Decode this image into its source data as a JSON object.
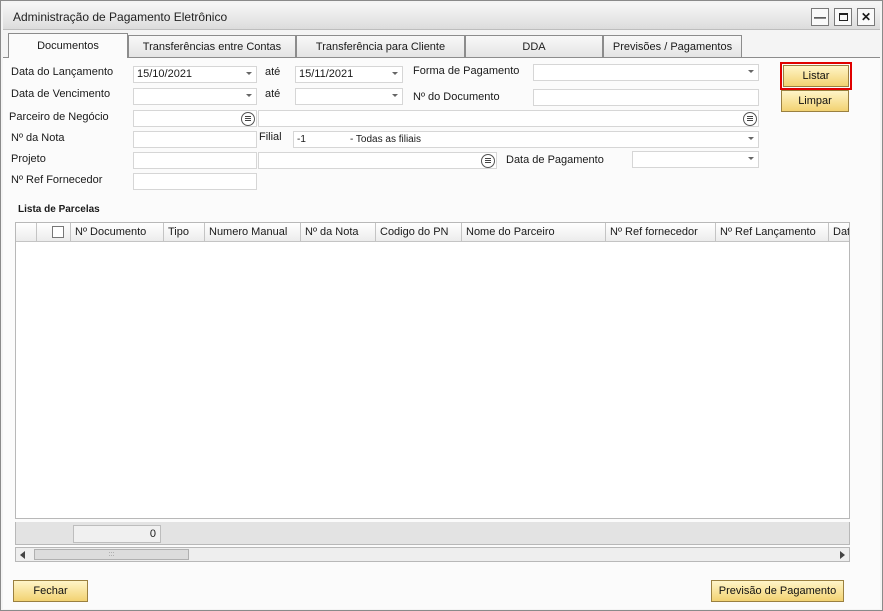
{
  "window": {
    "title": "Administração de Pagamento Eletrônico"
  },
  "tabs": [
    "Documentos",
    "Transferências entre Contas",
    "Transferência para Cliente",
    "DDA",
    "Previsões / Pagamentos"
  ],
  "form": {
    "data_lancamento_label": "Data do Lançamento",
    "data_lancamento_from": "15/10/2021",
    "ate_label_1": "até",
    "data_lancamento_to": "15/11/2021",
    "forma_pagamento_label": "Forma de Pagamento",
    "forma_pagamento_value": "",
    "data_vencimento_label": "Data de Vencimento",
    "data_vencimento_from": "",
    "ate_label_2": "até",
    "data_vencimento_to": "",
    "num_documento_label": "Nº do Documento",
    "num_documento_value": "",
    "parceiro_label": "Parceiro de Negócio",
    "parceiro_code": "",
    "parceiro_name": "",
    "num_nota_label": "Nº da Nota",
    "num_nota_value": "",
    "filial_label": "Filial",
    "filial_code": "-1",
    "filial_desc": "- Todas as filiais",
    "projeto_label": "Projeto",
    "projeto_code": "",
    "projeto_name": "",
    "data_pagamento_label": "Data de Pagamento",
    "data_pagamento_value": "",
    "ref_fornecedor_label": "Nº Ref Fornecedor",
    "ref_fornecedor_value": ""
  },
  "buttons": {
    "listar": "Listar",
    "limpar": "Limpar",
    "fechar": "Fechar",
    "previsao": "Previsão de Pagamento"
  },
  "grid": {
    "title": "Lista de Parcelas",
    "columns": [
      "Nº Documento",
      "Tipo",
      "Numero Manual",
      "Nº da Nota",
      "Codigo do PN",
      "Nome do Parceiro",
      "Nº Ref fornecedor",
      "Nº Ref Lançamento",
      "Dat"
    ],
    "total": "0"
  },
  "colors": {
    "button_bg": "#f2d272",
    "highlight": "#e00000"
  }
}
